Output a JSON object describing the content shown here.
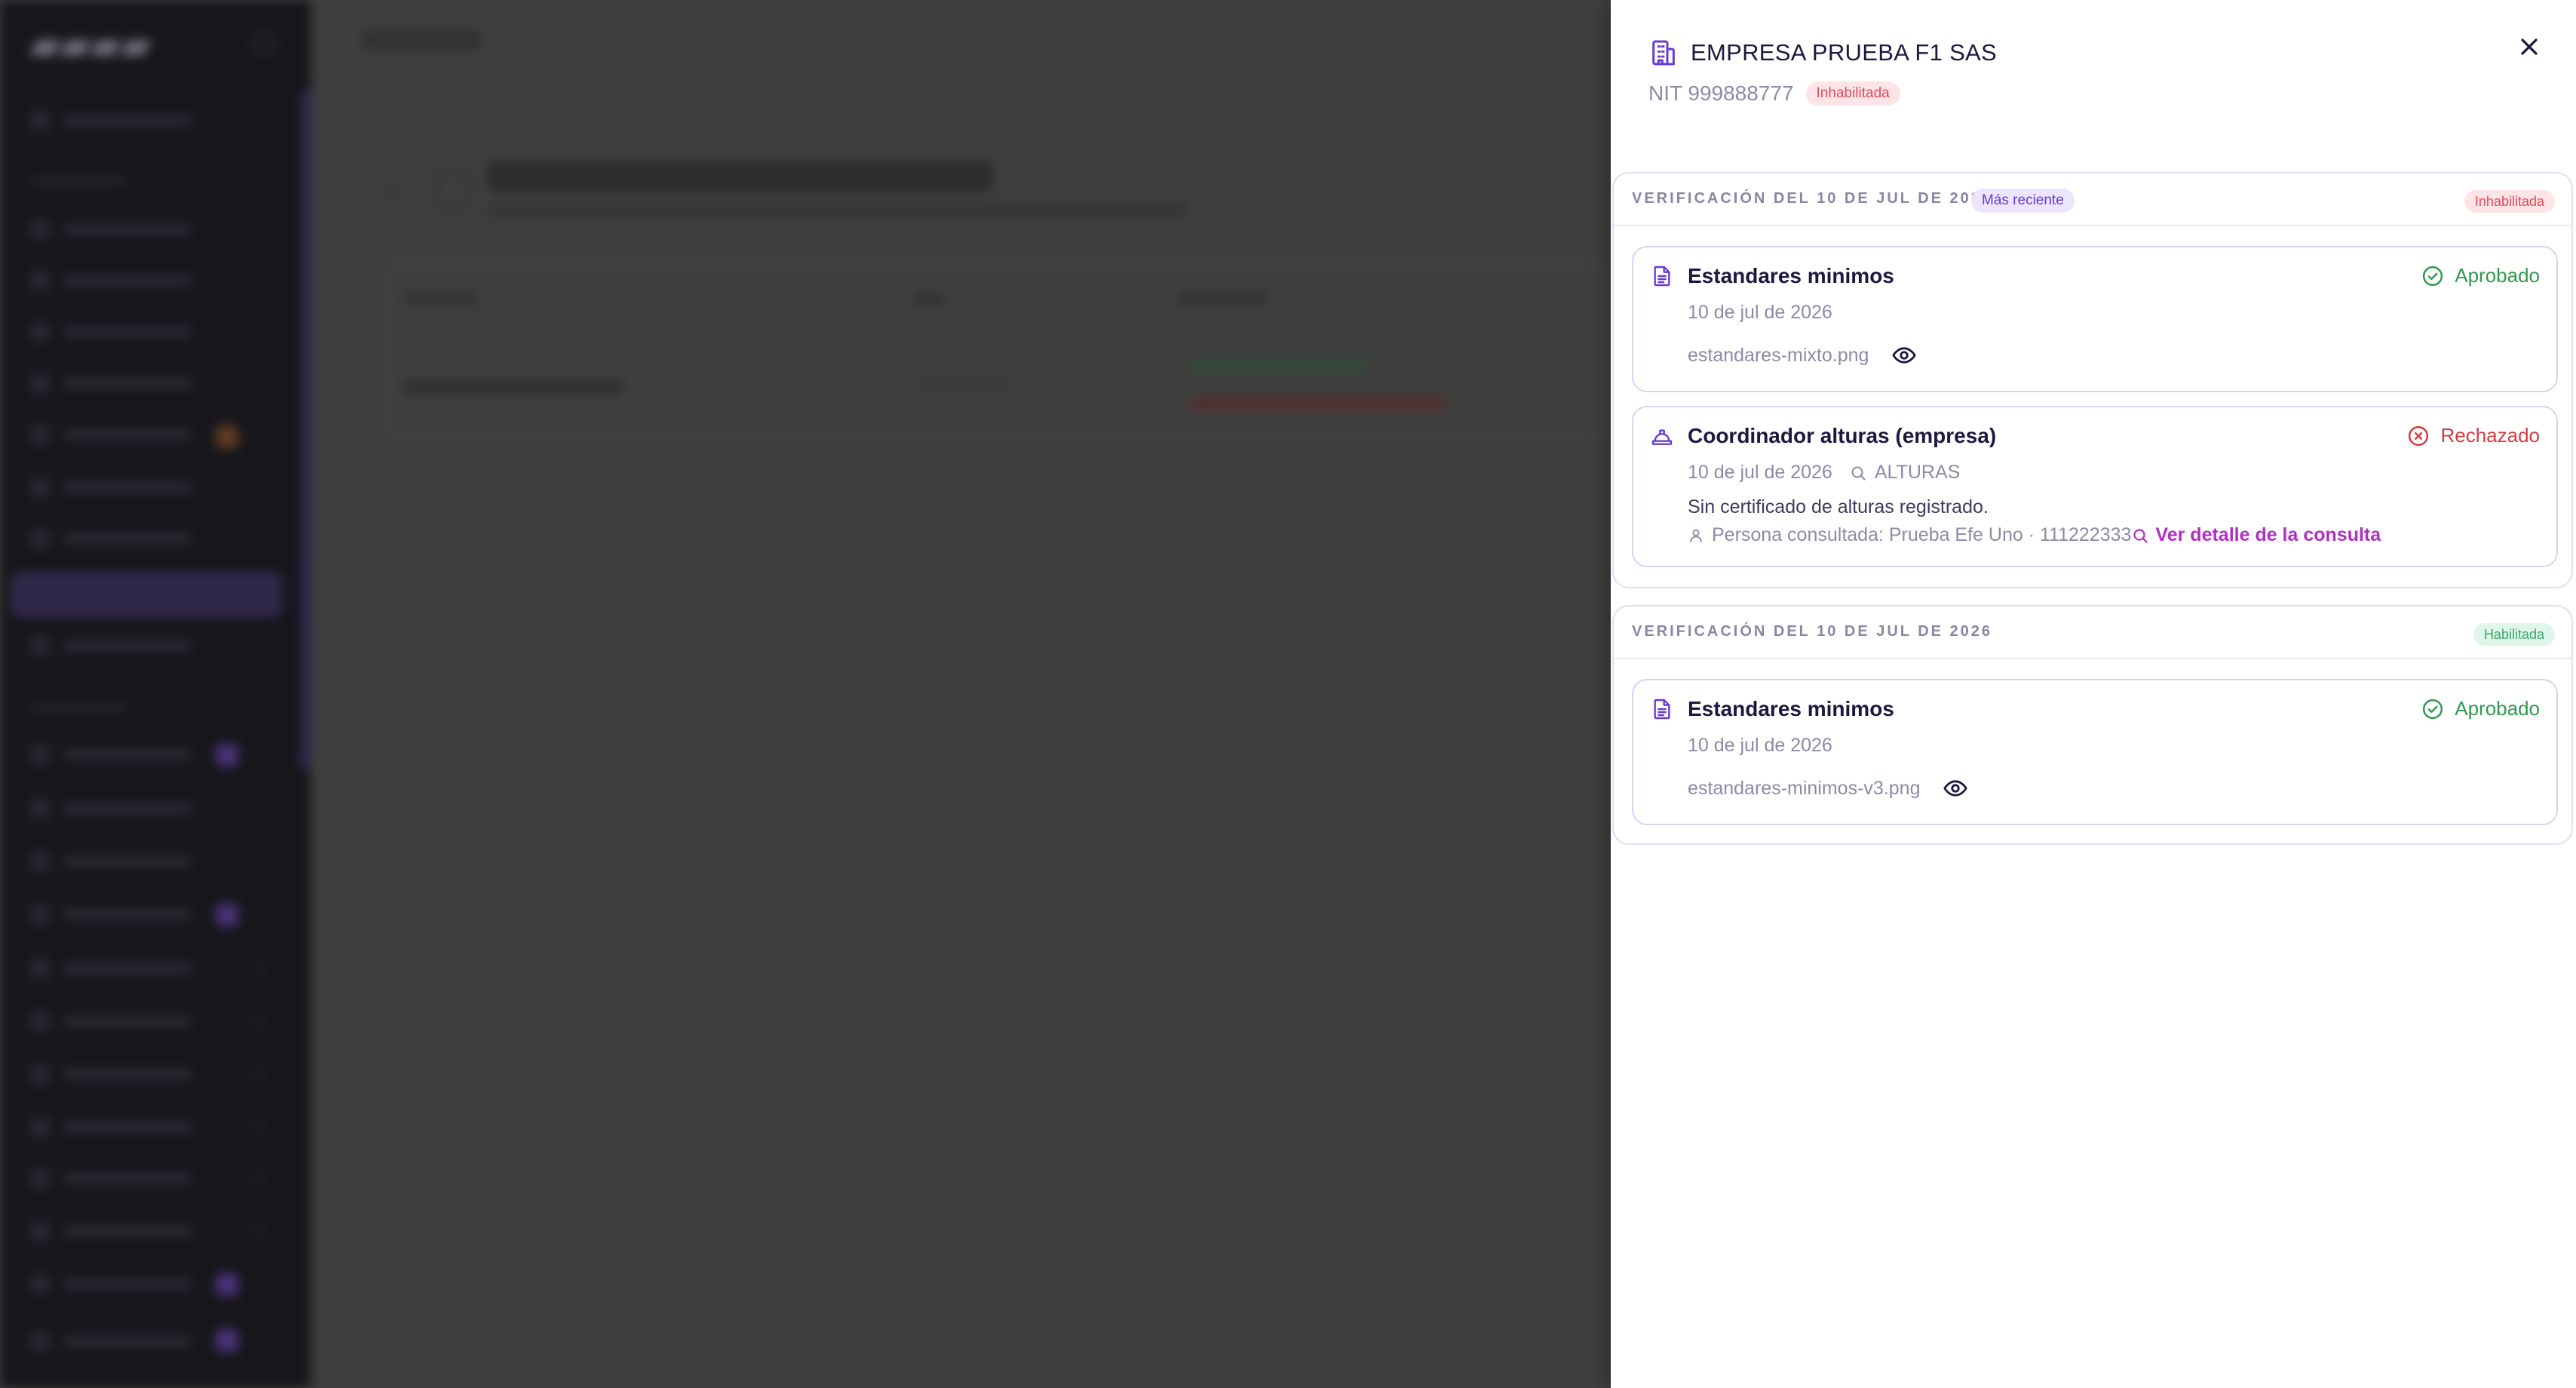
{
  "drawer": {
    "company_name": "EMPRESA PRUEBA F1 SAS",
    "nit_label": "NIT 999888777",
    "company_status": "Inhabilitada",
    "close_icon": "close-icon",
    "colors": {
      "accent": "#6a3bd2",
      "approved": "#2f9a4e",
      "rejected": "#d83a42",
      "link": "#b02fc6"
    },
    "verifications": [
      {
        "title": "VERIFICACIÓN DEL 10 DE JUL DE 2026",
        "recent_badge": "Más reciente",
        "status": "Inhabilitada",
        "items": [
          {
            "title": "Estandares minimos",
            "icon": "document-icon",
            "status": "Aprobado",
            "date": "10 de jul de 2026",
            "file": "estandares-mixto.png"
          },
          {
            "title": "Coordinador alturas (empresa)",
            "icon": "hard-hat-icon",
            "status": "Rechazado",
            "date": "10 de jul de 2026",
            "query": "ALTURAS",
            "note": "Sin certificado de alturas registrado.",
            "person": "Persona consultada: Prueba Efe Uno · 111222333",
            "link": "Ver detalle de la consulta"
          }
        ]
      },
      {
        "title": "VERIFICACIÓN DEL 10 DE JUL DE 2026",
        "status": "Habilitada",
        "items": [
          {
            "title": "Estandares minimos",
            "icon": "document-icon",
            "status": "Aprobado",
            "date": "10 de jul de 2026",
            "file": "estandares-minimos-v3.png"
          }
        ]
      }
    ]
  }
}
